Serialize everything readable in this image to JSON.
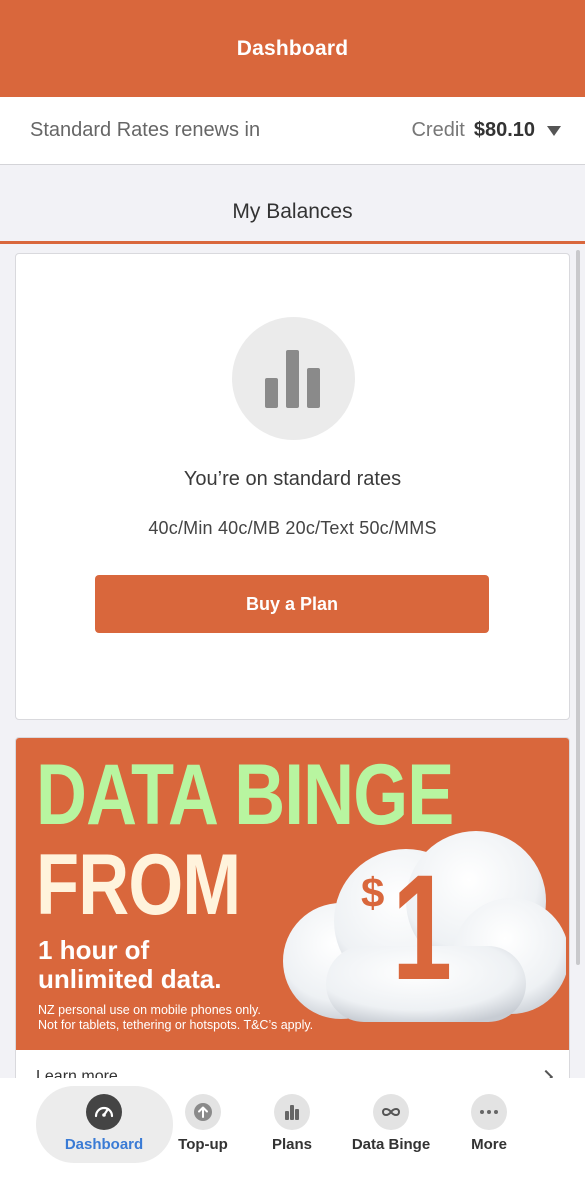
{
  "header": {
    "title": "Dashboard"
  },
  "rates_bar": {
    "left_text": "Standard Rates renews in",
    "credit_label": "Credit",
    "credit_value": "$80.10"
  },
  "section": {
    "title": "My Balances"
  },
  "balance_card": {
    "icon": "bar-chart-icon",
    "heading": "You’re on standard rates",
    "rates": "40c/Min 40c/MB 20c/Text 50c/MMS",
    "buy_label": "Buy a Plan"
  },
  "promo": {
    "line1": "DATA BINGE",
    "line2": "FROM",
    "price_symbol": "$",
    "price_value": "1",
    "subline1": "1 hour of",
    "subline2": "unlimited data.",
    "fine1": "NZ personal use on mobile phones only.",
    "fine2": "Not for tablets, tethering or hotspots. T&C’s apply.",
    "learn_more": "Learn more",
    "colors": {
      "background": "#d9673c",
      "headline_green": "#b8f5a0",
      "headline_cream": "#fff3dc"
    }
  },
  "tabs": [
    {
      "label": "Dashboard",
      "icon": "speedometer-icon",
      "active": true
    },
    {
      "label": "Top-up",
      "icon": "arrow-up-icon",
      "active": false
    },
    {
      "label": "Plans",
      "icon": "bar-chart-icon",
      "active": false
    },
    {
      "label": "Data Binge",
      "icon": "infinity-icon",
      "active": false
    },
    {
      "label": "More",
      "icon": "more-dots-icon",
      "active": false
    }
  ],
  "colors": {
    "accent": "#d9673c",
    "active_tab": "#3a7bd5"
  }
}
